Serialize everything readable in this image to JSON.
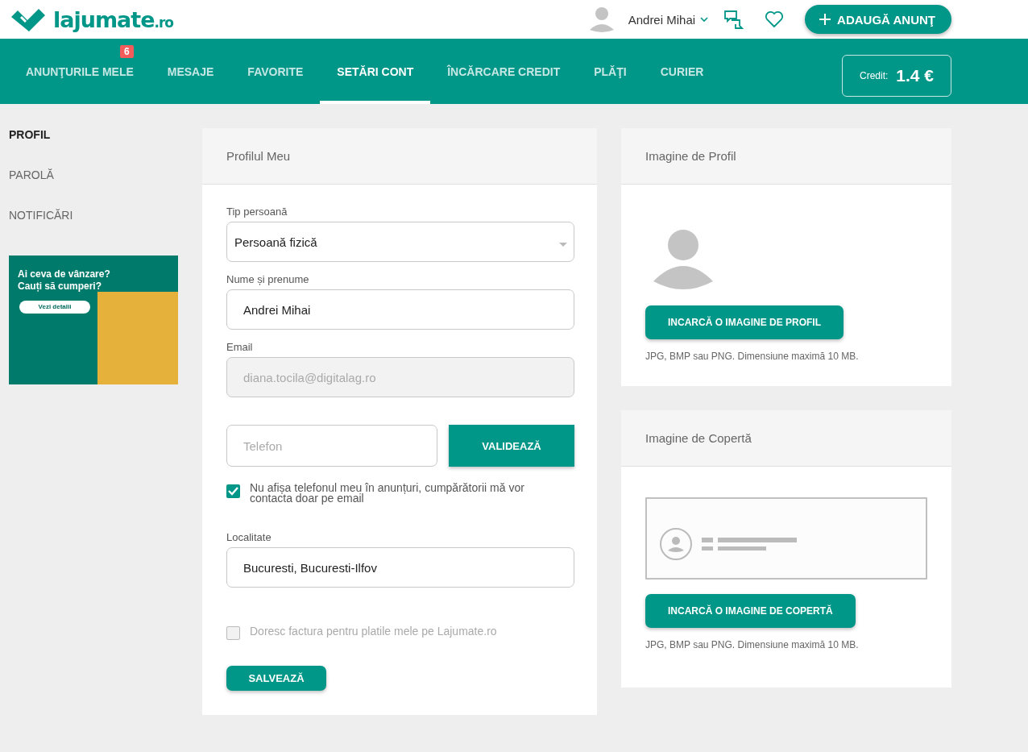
{
  "header": {
    "logo": {
      "name": "lajumate",
      "suffix": ".ro"
    },
    "user_name": "Andrei Mihai",
    "add_button": "ADAUGĂ ANUNŢ"
  },
  "nav": {
    "tabs": [
      {
        "label": "ANUNŢURILE MELE",
        "selected": false,
        "badge": "6"
      },
      {
        "label": "MESAJE",
        "selected": false
      },
      {
        "label": "FAVORITE",
        "selected": false
      },
      {
        "label": "SETĂRI CONT",
        "selected": true
      },
      {
        "label": "ÎNCĂRCARE CREDIT",
        "selected": false
      },
      {
        "label": "PLĂŢI",
        "selected": false
      },
      {
        "label": "CURIER",
        "selected": false
      }
    ],
    "credit": {
      "label": "Credit:",
      "value": "1.4 €"
    }
  },
  "sidebar": {
    "items": [
      {
        "label": "PROFIL",
        "selected": true
      },
      {
        "label": "PAROLĂ",
        "selected": false
      },
      {
        "label": "NOTIFICĂRI",
        "selected": false
      }
    ],
    "banner": {
      "headline": "Ai ceva de vânzare?\nCauți să cumperi?",
      "button": "Vezi detalii"
    }
  },
  "profile_form": {
    "title": "Profilul Meu",
    "fields": [
      {
        "kind": "select",
        "label": "Tip persoană",
        "value": "Persoană fizică"
      },
      {
        "kind": "text",
        "label": "Nume și prenume",
        "value": "Andrei Mihai",
        "disabled": false
      },
      {
        "kind": "text",
        "label": "Email",
        "value": "diana.tocila@digitalag.ro",
        "disabled": true
      },
      {
        "kind": "phone",
        "placeholder": "Telefon",
        "button": "VALIDEAZĂ"
      },
      {
        "kind": "checkbox",
        "label": "Nu afișa telefonul meu în anunțuri, cumpărătorii mă vor contacta doar pe email",
        "checked": true,
        "disabled": false
      },
      {
        "kind": "text",
        "label": "Localitate",
        "value": "Bucuresti, Bucuresti-Ilfov",
        "disabled": false
      },
      {
        "kind": "checkbox",
        "label": "Doresc factura pentru platile mele pe Lajumate.ro",
        "checked": false,
        "disabled": true
      }
    ],
    "save_button": "SALVEAZĂ"
  },
  "profile_image": {
    "title": "Imagine de Profil",
    "button": "INCARCĂ O IMAGINE DE PROFIL",
    "hint": "JPG, BMP sau PNG. Dimensiune maximă 10 MB."
  },
  "cover_image": {
    "title": "Imagine de Copertă",
    "button": "INCARCĂ O IMAGINE DE COPERTĂ",
    "hint": "JPG, BMP sau PNG. Dimensiune maximă 10 MB."
  }
}
